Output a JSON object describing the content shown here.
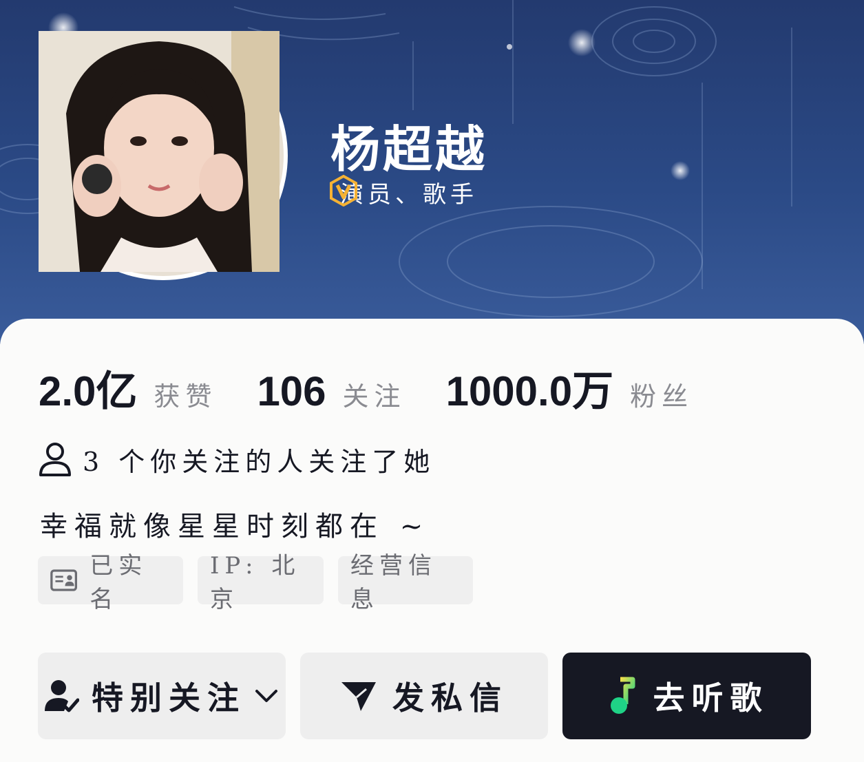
{
  "profile": {
    "name": "杨超越",
    "verification": "演员、歌手"
  },
  "stats": [
    {
      "value": "2.0亿",
      "label": "获赞"
    },
    {
      "value": "106",
      "label": "关注"
    },
    {
      "value": "1000.0万",
      "label": "粉丝"
    }
  ],
  "mutual_follow": "3 个你关注的人关注了她",
  "bio": "幸福就像星星时刻都在 ~",
  "tags": {
    "verified": "已实名",
    "ip": "IP: 北京",
    "business": "经营信息"
  },
  "actions": {
    "follow": "特别关注",
    "message": "发私信",
    "music": "去听歌"
  },
  "colors": {
    "banner": "#2b4a86",
    "badge": "#f5b234",
    "text_primary": "#161823",
    "text_secondary": "#8a8b91",
    "music_button": "#161823"
  },
  "icons": [
    "verified-v-icon",
    "person-icon",
    "id-card-icon",
    "person-check-icon",
    "chevron-down-icon",
    "send-icon",
    "music-note-icon"
  ]
}
